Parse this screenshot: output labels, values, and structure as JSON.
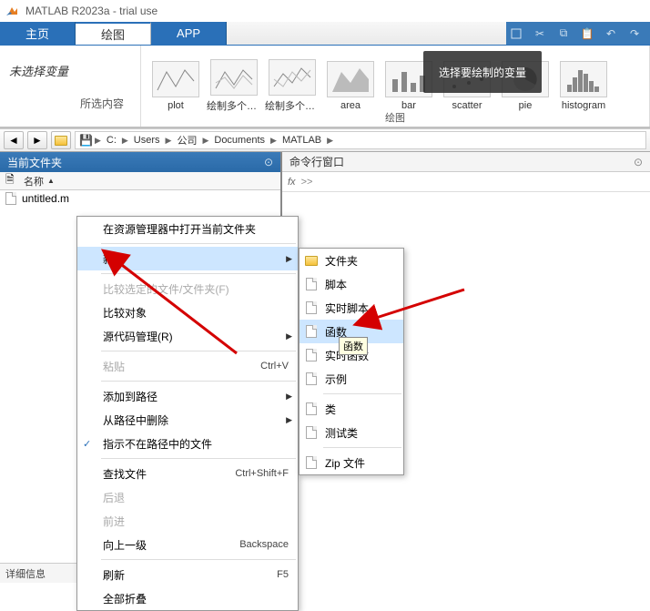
{
  "window": {
    "title": "MATLAB R2023a - trial use"
  },
  "tabs": {
    "home": "主页",
    "plots": "绘图",
    "apps": "APP"
  },
  "ribbon": {
    "no_var": "未选择变量",
    "all_content": "所选内容",
    "section": "绘图",
    "overlay": "选择要绘制的变量",
    "items": [
      "plot",
      "绘制多个序...",
      "绘制多个序...",
      "area",
      "bar",
      "scatter",
      "pie",
      "histogram"
    ]
  },
  "address": {
    "root": "C:",
    "p1": "Users",
    "p2": "公司",
    "p3": "Documents",
    "p4": "MATLAB"
  },
  "folder_panel": {
    "title": "当前文件夹",
    "col_name": "名称",
    "file1": "untitled.m"
  },
  "details": {
    "label": "详细信息"
  },
  "cmd_panel": {
    "title": "命令行窗口",
    "fx": "fx",
    "prompt": ">>"
  },
  "ctx1": {
    "open_in_explorer": "在资源管理器中打开当前文件夹",
    "new": "新建",
    "compare_selected": "比较选定的文件/文件夹(F)",
    "compare_against": "比较对象",
    "source_control": "源代码管理(R)",
    "paste": "粘贴",
    "paste_sc": "Ctrl+V",
    "add_to_path": "添加到路径",
    "remove_from_path": "从路径中删除",
    "indicate_not_on_path": "指示不在路径中的文件",
    "find_files": "查找文件",
    "find_sc": "Ctrl+Shift+F",
    "back": "后退",
    "forward": "前进",
    "up_one": "向上一级",
    "up_sc": "Backspace",
    "refresh": "刷新",
    "refresh_sc": "F5",
    "collapse_all": "全部折叠"
  },
  "ctx2": {
    "folder": "文件夹",
    "script": "脚本",
    "live_script": "实时脚本",
    "function": "函数",
    "live_function": "实时函数",
    "example": "示例",
    "class": "类",
    "test_class": "测试类",
    "zip": "Zip 文件"
  },
  "tooltip": {
    "text": "函数"
  }
}
